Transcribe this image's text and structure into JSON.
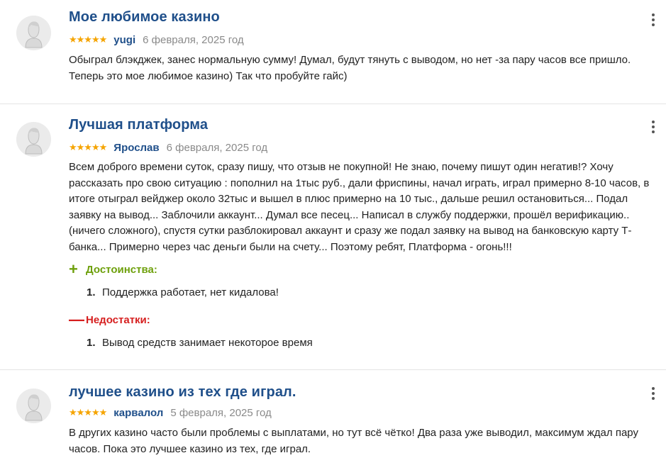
{
  "reviews": [
    {
      "title": "Мое любимое казино",
      "stars": "★★★★★",
      "rating": 5,
      "author": "yugi",
      "date": "6 февраля, 2025 год",
      "text": "Обыграл блэкджек, занес нормальную сумму! Думал, будут тянуть с выводом, но нет -за пару часов все пришло. Теперь это мое любимое казино) Так что пробуйте гайс)"
    },
    {
      "title": "Лучшая платформа",
      "stars": "★★★★★",
      "rating": 5,
      "author": "Ярослав",
      "date": "6 февраля, 2025 год",
      "text": "Всем доброго времени суток, сразу пишу, что отзыв не покупной! Не знаю, почему пишут один негатив!? Хочу рассказать про свою ситуацию : пополнил на 1тыс руб., дали фриспины, начал играть, играл примерно 8-10 часов, в итоге отыграл вейджер около 32тыс и вышел в плюс примерно на 10 тыс., дальше решил остановиться... Подал заявку на вывод... Заблочили аккаунт... Думал все песец... Написал в службу поддержки, прошёл верификацию.. (ничего сложного), спустя сутки разблокировал аккаунт и сразу же подал заявку на вывод на банковскую карту Т-банка... Примерно через час деньги были на счету... Поэтому ребят, Платформа - огонь!!!",
      "pros_sign": "+",
      "pros_label": "Достоинства:",
      "pros": [
        {
          "num": "1.",
          "text": "Поддержка работает, нет кидалова!"
        }
      ],
      "cons_sign": "—",
      "cons_label": "Недостатки:",
      "cons": [
        {
          "num": "1.",
          "text": "Вывод средств занимает некоторое время"
        }
      ]
    },
    {
      "title": "лучшее казино из тех где играл.",
      "stars": "★★★★★",
      "rating": 5,
      "author": "карвалол",
      "date": "5 февраля, 2025 год",
      "text": "В других казино часто были проблемы с выплатами, но тут всё чётко! Два раза уже выводил, максимум ждал пару часов. Пока это лучшее казино из тех, где играл."
    }
  ],
  "icons": {
    "avatar": "user-avatar-icon",
    "menu": "kebab-menu-icon",
    "star": "star-icon"
  },
  "colors": {
    "title": "#1f4f8a",
    "author": "#1f4f8a",
    "stars": "#f5a400",
    "date": "#8a8a8a",
    "pros": "#6ea00c",
    "cons": "#d62020"
  }
}
